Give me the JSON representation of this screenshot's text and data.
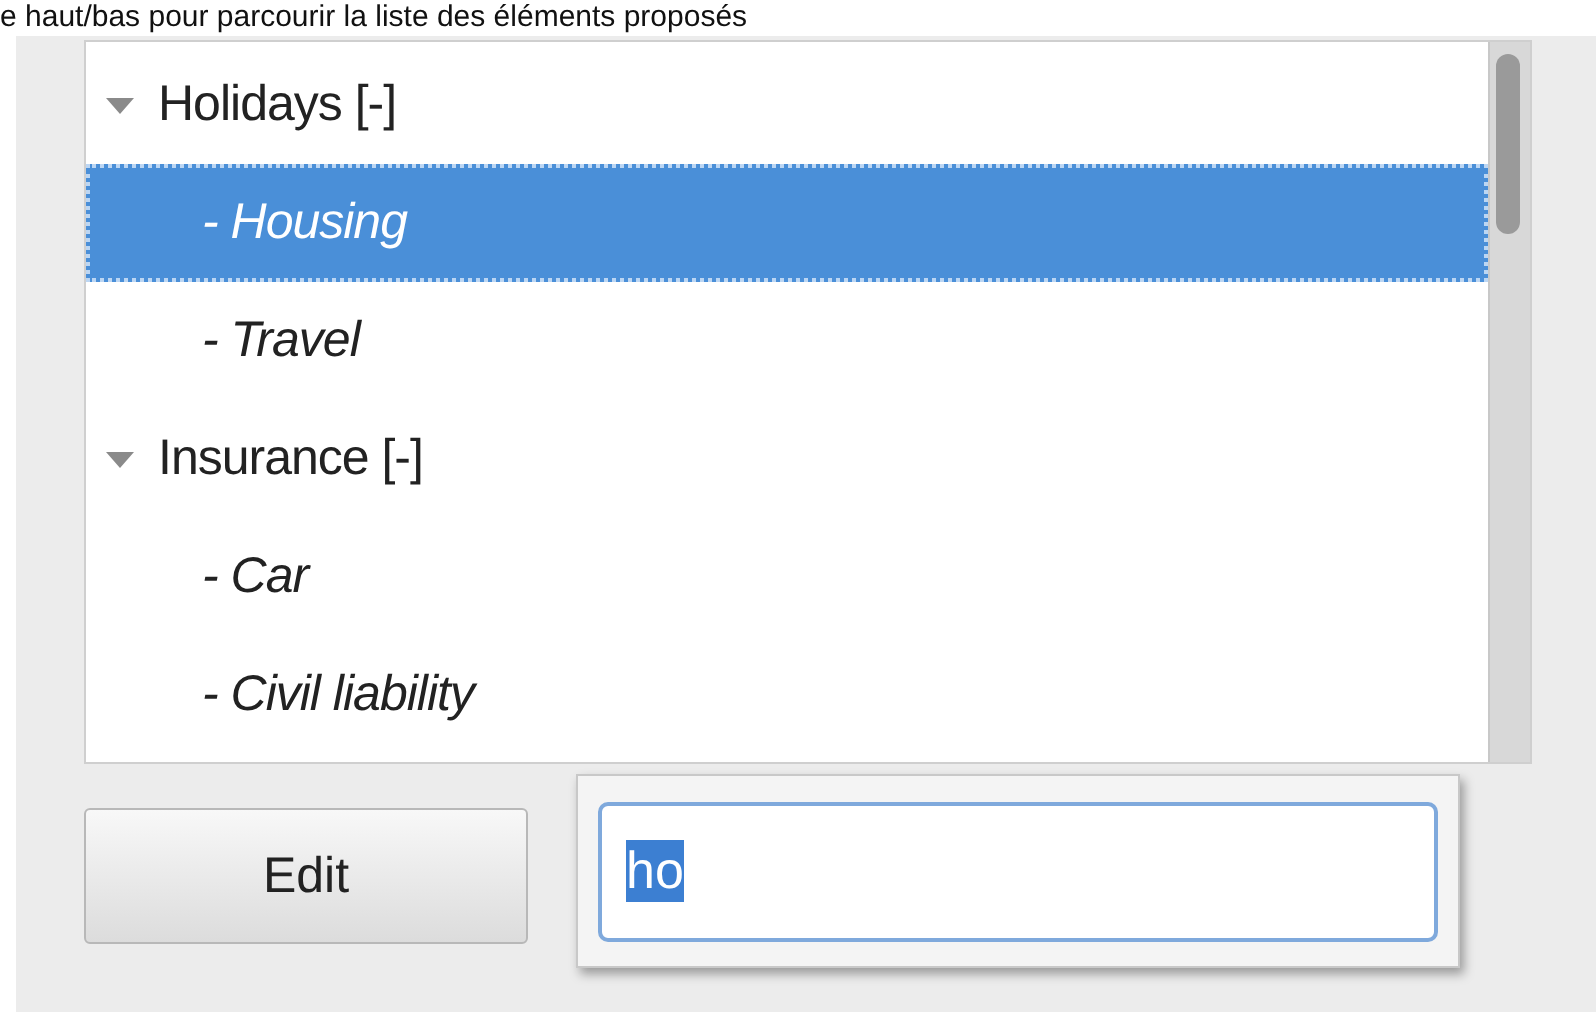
{
  "caption": "e haut/bas pour parcourir la liste des éléments proposés",
  "tree": [
    {
      "label": "Holidays [-]",
      "expanded": true,
      "selected": false,
      "children": [
        {
          "label": "- Housing",
          "selected": true
        },
        {
          "label": "- Travel",
          "selected": false
        }
      ]
    },
    {
      "label": "Insurance [-]",
      "expanded": true,
      "selected": false,
      "children": [
        {
          "label": "- Car",
          "selected": false
        },
        {
          "label": "- Civil liability",
          "selected": false
        }
      ]
    }
  ],
  "edit_button": "Edit",
  "search_popup": {
    "value": "ho"
  }
}
